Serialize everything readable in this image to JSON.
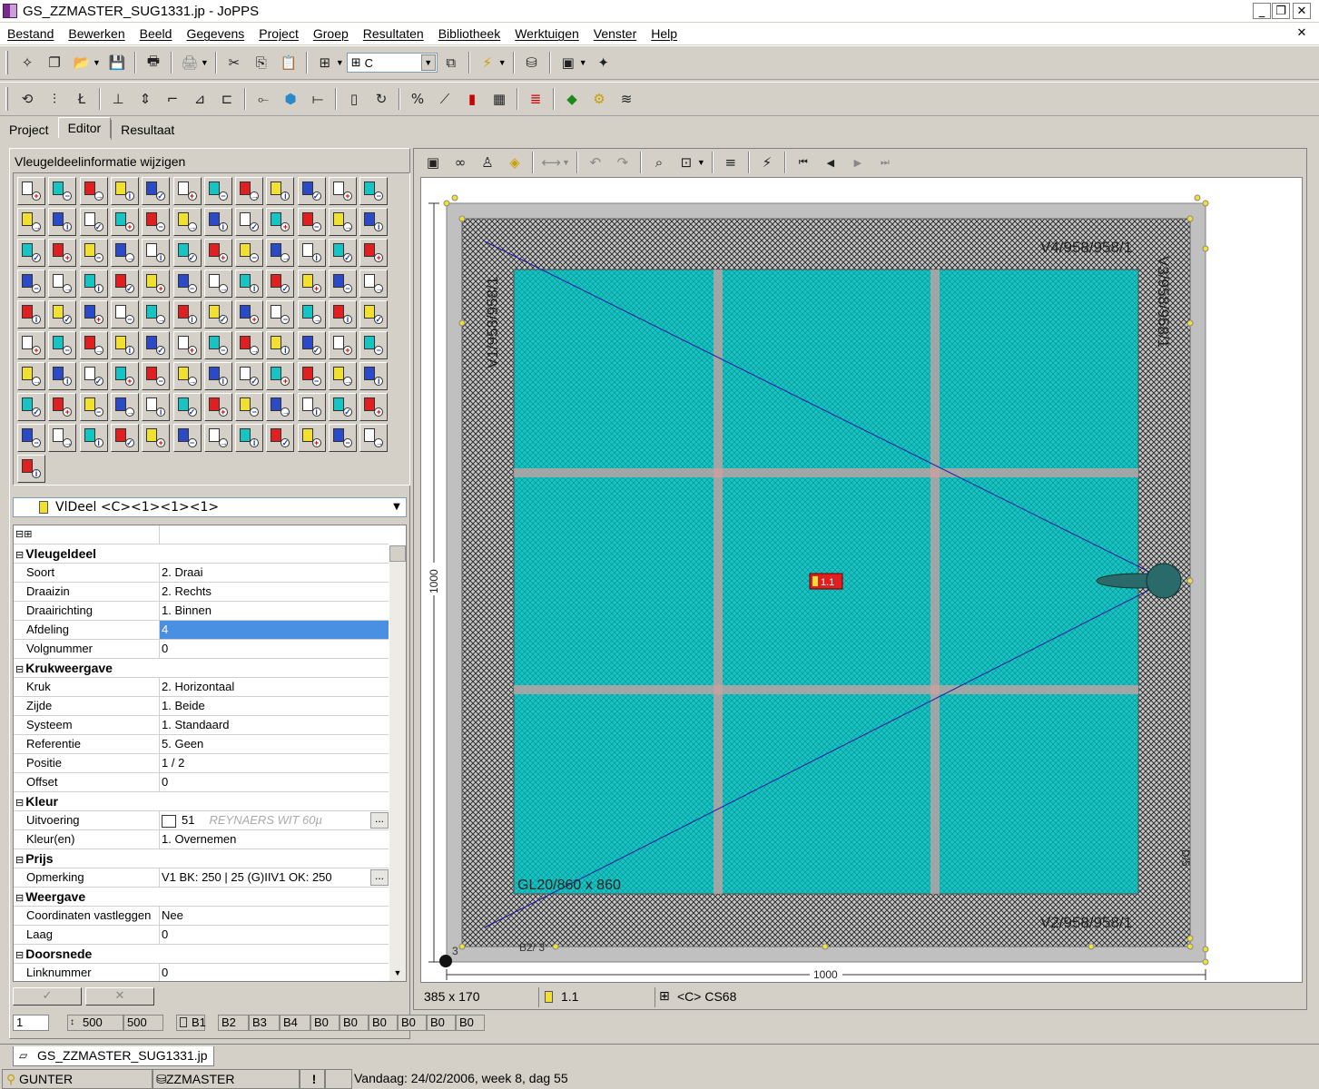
{
  "window": {
    "title": "GS_ZZMASTER_SUG1331.jp - JoPPS"
  },
  "menu": [
    "Bestand",
    "Bewerken",
    "Beeld",
    "Gegevens",
    "Project",
    "Groep",
    "Resultaten",
    "Bibliotheek",
    "Werktuigen",
    "Venster",
    "Help"
  ],
  "toolbar": {
    "combo_value": "C"
  },
  "tabs": [
    {
      "label": "Project"
    },
    {
      "label": "Editor"
    },
    {
      "label": "Resultaat"
    }
  ],
  "left_panel": {
    "title": "Vleugeldeelinformatie wijzigen",
    "combo_value": "VlDeel <C><1><1><1>",
    "properties": [
      {
        "section": "Vleugeldeel"
      },
      {
        "key": "Soort",
        "value": "2. Draai"
      },
      {
        "key": "Draaizin",
        "value": "2. Rechts"
      },
      {
        "key": "Draairichting",
        "value": "1. Binnen"
      },
      {
        "key": "Afdeling",
        "value": "4",
        "selected": true
      },
      {
        "key": "Volgnummer",
        "value": "0"
      },
      {
        "section": "Krukweergave"
      },
      {
        "key": "Kruk",
        "value": "2. Horizontaal"
      },
      {
        "key": "Zijde",
        "value": "1. Beide"
      },
      {
        "key": "Systeem",
        "value": "1. Standaard"
      },
      {
        "key": "Referentie",
        "value": "5. Geen"
      },
      {
        "key": "Positie",
        "value": "1 / 2"
      },
      {
        "key": "Offset",
        "value": "0"
      },
      {
        "section": "Kleur"
      },
      {
        "key": "Uitvoering",
        "value": "51",
        "extra": "REYNAERS WIT 60µ",
        "dots": true
      },
      {
        "key": "Kleur(en)",
        "value": "1. Overnemen"
      },
      {
        "section": "Prijs"
      },
      {
        "key": "Opmerking",
        "value": "V1 BK: 250  |    25  (G)IIV1 OK: 250",
        "dots": true
      },
      {
        "section": "Weergave"
      },
      {
        "key": "Coordinaten vastleggen",
        "value": "Nee"
      },
      {
        "key": "Laag",
        "value": "0"
      },
      {
        "section": "Doorsnede"
      },
      {
        "key": "Linknummer",
        "value": "0"
      }
    ],
    "ok_label": "✓",
    "cancel_label": "✕"
  },
  "bottom_fields": {
    "f1": "1",
    "f2": "500",
    "f3": "500",
    "b": [
      "B1",
      "B2",
      "B3",
      "B4",
      "B0",
      "B0",
      "B0",
      "B0",
      "B0",
      "B0"
    ]
  },
  "drawing": {
    "label_top": "V4/958/958/1",
    "label_left": "V1/958/958/1",
    "label_right": "V3/958/958/1",
    "label_bottom": "V2/958/958/1",
    "label_glass": "GL20/860 x 860",
    "label_bottom_partial": "B2/ 3",
    "label_right_partial": "D/5",
    "dim_width": "1000",
    "dim_height": "1000",
    "badge": "1.1",
    "corner_number": "3",
    "colors": {
      "glass": "#17c4c4",
      "frame": "#c0c0c0",
      "hatch": "#303030",
      "grid": "#d0a0a0"
    }
  },
  "canvas_status": {
    "size": "385 x 170",
    "part": "1.1",
    "profile": "<C> CS68"
  },
  "doc_tab": "GS_ZZMASTER_SUG1331.jp",
  "status": {
    "user": "GUNTER",
    "db": "ZZMASTER",
    "alert": "!",
    "date": "Vandaag: 24/02/2006, week 8, dag 55"
  }
}
